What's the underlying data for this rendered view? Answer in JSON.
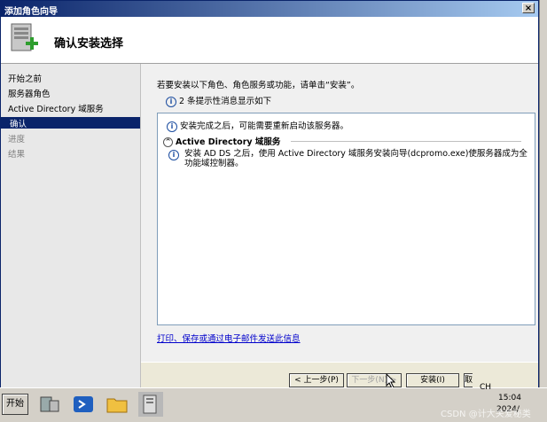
{
  "window": {
    "title": "添加角色向导",
    "close_glyph": "×"
  },
  "header": {
    "title": "确认安装选择",
    "icon": "server-add-icon"
  },
  "sidebar": {
    "items": [
      {
        "label": "开始之前",
        "state": "normal"
      },
      {
        "label": "服务器角色",
        "state": "normal"
      },
      {
        "label": "Active Directory 域服务",
        "state": "normal"
      },
      {
        "label": "确认",
        "state": "active"
      },
      {
        "label": "进度",
        "state": "disabled"
      },
      {
        "label": "结果",
        "state": "disabled"
      }
    ]
  },
  "main": {
    "intro": "若要安装以下角色、角色服务或功能，请单击“安装”。",
    "info_count": "2 条提示性消息显示如下",
    "box": {
      "row1": "安装完成之后，可能需要重新启动该服务器。",
      "section_title": "Active Directory 域服务",
      "detail": "安装 AD DS 之后，使用 Active Directory 域服务安装向导(dcpromo.exe)使服务器成为全功能域控制器。"
    },
    "link": "打印、保存或通过电子邮件发送此信息"
  },
  "footer": {
    "prev": "< 上一步(P)",
    "next": "下一步(N) >",
    "install": "安装(I)",
    "cancel": "取消"
  },
  "taskbar": {
    "start": "开始",
    "lang": "CH",
    "time": "15:04",
    "date": "2024/"
  },
  "watermark": "CSDN @计大关爱秘类",
  "colors": {
    "accent": "#0a246a",
    "link": "#0000cc",
    "title_gradient_end": "#a6caf0"
  }
}
